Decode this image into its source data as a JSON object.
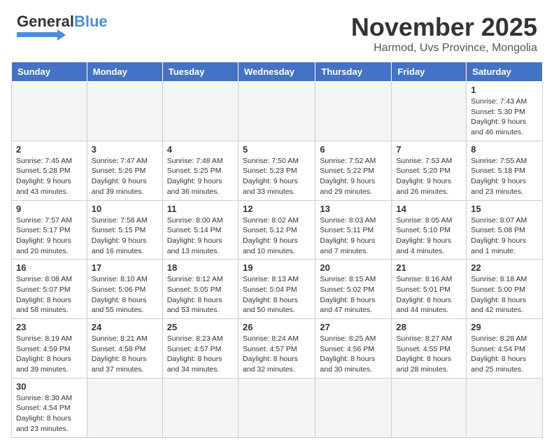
{
  "header": {
    "logo_general": "General",
    "logo_blue": "Blue",
    "title": "November 2025",
    "subtitle": "Harmod, Uvs Province, Mongolia"
  },
  "days_of_week": [
    "Sunday",
    "Monday",
    "Tuesday",
    "Wednesday",
    "Thursday",
    "Friday",
    "Saturday"
  ],
  "weeks": [
    [
      {
        "day": "",
        "info": ""
      },
      {
        "day": "",
        "info": ""
      },
      {
        "day": "",
        "info": ""
      },
      {
        "day": "",
        "info": ""
      },
      {
        "day": "",
        "info": ""
      },
      {
        "day": "",
        "info": ""
      },
      {
        "day": "1",
        "info": "Sunrise: 7:43 AM\nSunset: 5:30 PM\nDaylight: 9 hours and 46 minutes."
      }
    ],
    [
      {
        "day": "2",
        "info": "Sunrise: 7:45 AM\nSunset: 5:28 PM\nDaylight: 9 hours and 43 minutes."
      },
      {
        "day": "3",
        "info": "Sunrise: 7:47 AM\nSunset: 5:26 PM\nDaylight: 9 hours and 39 minutes."
      },
      {
        "day": "4",
        "info": "Sunrise: 7:48 AM\nSunset: 5:25 PM\nDaylight: 9 hours and 36 minutes."
      },
      {
        "day": "5",
        "info": "Sunrise: 7:50 AM\nSunset: 5:23 PM\nDaylight: 9 hours and 33 minutes."
      },
      {
        "day": "6",
        "info": "Sunrise: 7:52 AM\nSunset: 5:22 PM\nDaylight: 9 hours and 29 minutes."
      },
      {
        "day": "7",
        "info": "Sunrise: 7:53 AM\nSunset: 5:20 PM\nDaylight: 9 hours and 26 minutes."
      },
      {
        "day": "8",
        "info": "Sunrise: 7:55 AM\nSunset: 5:18 PM\nDaylight: 9 hours and 23 minutes."
      }
    ],
    [
      {
        "day": "9",
        "info": "Sunrise: 7:57 AM\nSunset: 5:17 PM\nDaylight: 9 hours and 20 minutes."
      },
      {
        "day": "10",
        "info": "Sunrise: 7:58 AM\nSunset: 5:15 PM\nDaylight: 9 hours and 16 minutes."
      },
      {
        "day": "11",
        "info": "Sunrise: 8:00 AM\nSunset: 5:14 PM\nDaylight: 9 hours and 13 minutes."
      },
      {
        "day": "12",
        "info": "Sunrise: 8:02 AM\nSunset: 5:12 PM\nDaylight: 9 hours and 10 minutes."
      },
      {
        "day": "13",
        "info": "Sunrise: 8:03 AM\nSunset: 5:11 PM\nDaylight: 9 hours and 7 minutes."
      },
      {
        "day": "14",
        "info": "Sunrise: 8:05 AM\nSunset: 5:10 PM\nDaylight: 9 hours and 4 minutes."
      },
      {
        "day": "15",
        "info": "Sunrise: 8:07 AM\nSunset: 5:08 PM\nDaylight: 9 hours and 1 minute."
      }
    ],
    [
      {
        "day": "16",
        "info": "Sunrise: 8:08 AM\nSunset: 5:07 PM\nDaylight: 8 hours and 58 minutes."
      },
      {
        "day": "17",
        "info": "Sunrise: 8:10 AM\nSunset: 5:06 PM\nDaylight: 8 hours and 55 minutes."
      },
      {
        "day": "18",
        "info": "Sunrise: 8:12 AM\nSunset: 5:05 PM\nDaylight: 8 hours and 53 minutes."
      },
      {
        "day": "19",
        "info": "Sunrise: 8:13 AM\nSunset: 5:04 PM\nDaylight: 8 hours and 50 minutes."
      },
      {
        "day": "20",
        "info": "Sunrise: 8:15 AM\nSunset: 5:02 PM\nDaylight: 8 hours and 47 minutes."
      },
      {
        "day": "21",
        "info": "Sunrise: 8:16 AM\nSunset: 5:01 PM\nDaylight: 8 hours and 44 minutes."
      },
      {
        "day": "22",
        "info": "Sunrise: 8:18 AM\nSunset: 5:00 PM\nDaylight: 8 hours and 42 minutes."
      }
    ],
    [
      {
        "day": "23",
        "info": "Sunrise: 8:19 AM\nSunset: 4:59 PM\nDaylight: 8 hours and 39 minutes."
      },
      {
        "day": "24",
        "info": "Sunrise: 8:21 AM\nSunset: 4:58 PM\nDaylight: 8 hours and 37 minutes."
      },
      {
        "day": "25",
        "info": "Sunrise: 8:23 AM\nSunset: 4:57 PM\nDaylight: 8 hours and 34 minutes."
      },
      {
        "day": "26",
        "info": "Sunrise: 8:24 AM\nSunset: 4:57 PM\nDaylight: 8 hours and 32 minutes."
      },
      {
        "day": "27",
        "info": "Sunrise: 8:25 AM\nSunset: 4:56 PM\nDaylight: 8 hours and 30 minutes."
      },
      {
        "day": "28",
        "info": "Sunrise: 8:27 AM\nSunset: 4:55 PM\nDaylight: 8 hours and 28 minutes."
      },
      {
        "day": "29",
        "info": "Sunrise: 8:28 AM\nSunset: 4:54 PM\nDaylight: 8 hours and 25 minutes."
      }
    ],
    [
      {
        "day": "30",
        "info": "Sunrise: 8:30 AM\nSunset: 4:54 PM\nDaylight: 8 hours and 23 minutes."
      },
      {
        "day": "",
        "info": ""
      },
      {
        "day": "",
        "info": ""
      },
      {
        "day": "",
        "info": ""
      },
      {
        "day": "",
        "info": ""
      },
      {
        "day": "",
        "info": ""
      },
      {
        "day": "",
        "info": ""
      }
    ]
  ]
}
